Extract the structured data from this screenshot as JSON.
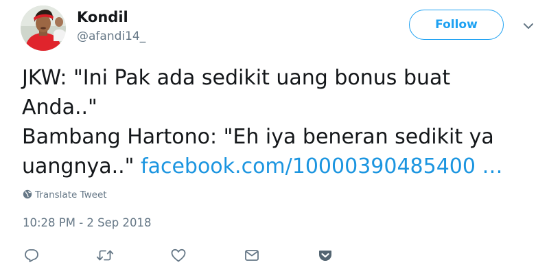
{
  "author": {
    "display_name": "Kondil",
    "handle": "@afandi14_"
  },
  "follow_label": "Follow",
  "tweet": {
    "text_line1": "JKW: \"Ini Pak ada sedikit uang bonus buat\nAnda..\"\nBambang Hartono: \"Eh iya beneran sedikit ya\nuangnya..\" ",
    "link_text": "facebook.com/10000390485400 …"
  },
  "translate_label": "Translate Tweet",
  "timestamp": "10:28 PM - 2 Sep 2018",
  "icons": {
    "reply": "reply-icon",
    "retweet": "retweet-icon",
    "like": "heart-icon",
    "dm": "envelope-icon",
    "pocket": "pocket-icon",
    "caret": "chevron-down-icon",
    "globe": "globe-icon"
  },
  "colors": {
    "accent": "#1da1f2",
    "link": "#1b95e0",
    "text": "#14171a",
    "secondary": "#657786",
    "pocket": "#ef4056"
  }
}
